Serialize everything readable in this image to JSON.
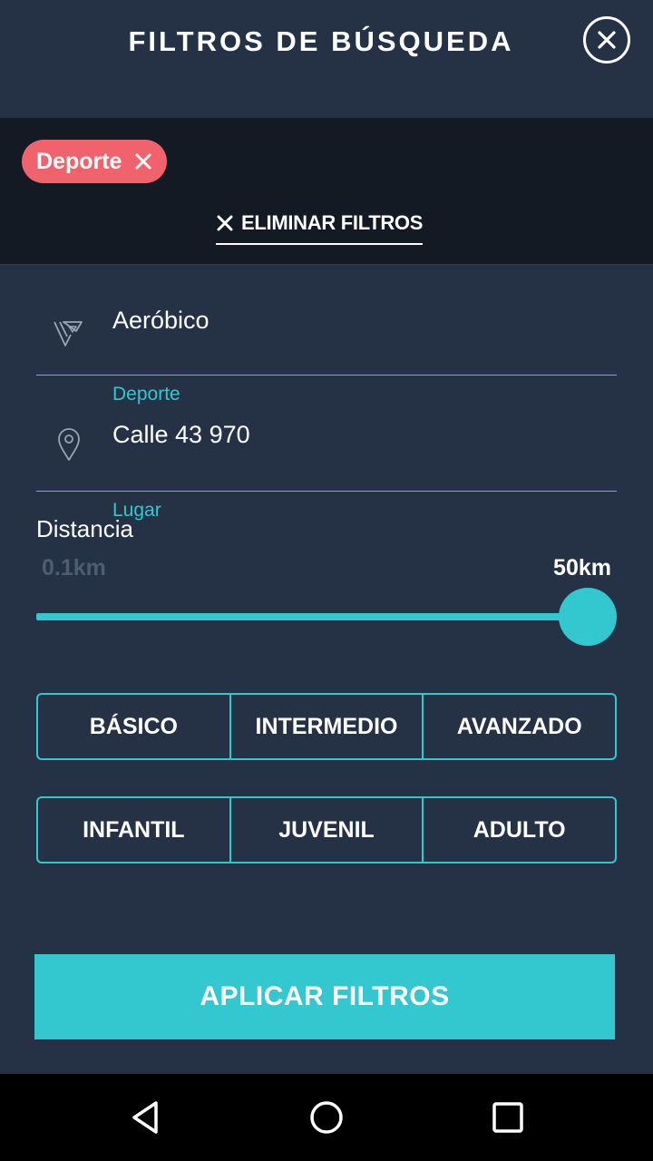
{
  "header": {
    "title": "FILTROS DE BÚSQUEDA",
    "close_icon": "close-circle-icon"
  },
  "active_filters": {
    "chips": [
      {
        "label": "Deporte",
        "remove_icon": "close-icon"
      }
    ],
    "clear_label": "ELIMINAR FILTROS",
    "clear_icon": "close-icon"
  },
  "fields": {
    "sport": {
      "value": "Aeróbico",
      "label": "Deporte",
      "icon": "sport-logo-icon"
    },
    "place": {
      "value": "Calle 43 970",
      "label": "Lugar",
      "icon": "location-pin-icon"
    }
  },
  "distance": {
    "label": "Distancia",
    "min_label": "0.1km",
    "max_label": "50km",
    "value_fraction": 1.0
  },
  "levels": {
    "options": [
      "BÁSICO",
      "INTERMEDIO",
      "AVANZADO"
    ]
  },
  "ages": {
    "options": [
      "INFANTIL",
      "JUVENIL",
      "ADULTO"
    ]
  },
  "apply_button": {
    "label": "APLICAR FILTROS"
  },
  "colors": {
    "background": "#253246",
    "dark_panel": "#131a24",
    "accent": "#33c7d0",
    "chip": "#f0636c",
    "muted": "#4e5d74"
  },
  "navbar": {
    "icons": [
      "back-triangle-icon",
      "home-circle-icon",
      "recents-square-icon"
    ]
  }
}
